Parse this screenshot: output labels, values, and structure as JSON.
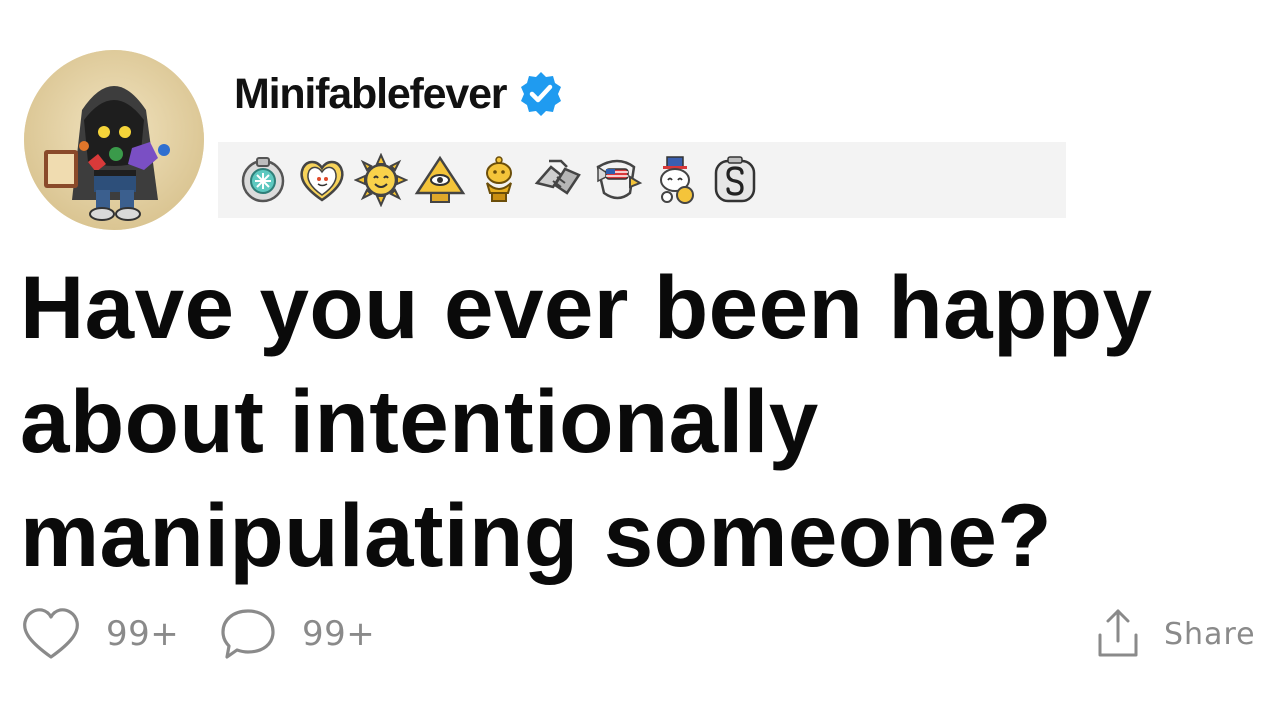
{
  "post": {
    "author": {
      "username": "Minifablefever",
      "verified": true,
      "avatar_icon": "hooded-character-avatar",
      "verified_icon": "verified-badge-icon"
    },
    "awards": [
      {
        "icon": "silver-medal-award-icon"
      },
      {
        "icon": "heart-snoo-award-icon"
      },
      {
        "icon": "sun-face-award-icon"
      },
      {
        "icon": "pyramid-eye-award-icon"
      },
      {
        "icon": "gold-trophy-snoo-award-icon"
      },
      {
        "icon": "handshake-award-icon"
      },
      {
        "icon": "eagle-award-icon"
      },
      {
        "icon": "snoo-sheriff-award-icon"
      },
      {
        "icon": "s-coin-award-icon"
      }
    ],
    "title": "Have you ever been happy about intentionally manipulating someone?",
    "actions": {
      "likes": "99+",
      "comments": "99+",
      "share_label": "Share"
    }
  },
  "colors": {
    "title_text": "#0a0a0a",
    "muted_text": "#8a8a8a",
    "verified_blue": "#1f9bf0",
    "awards_background": "#f3f3f3",
    "avatar_background": "#e6d6ad"
  }
}
